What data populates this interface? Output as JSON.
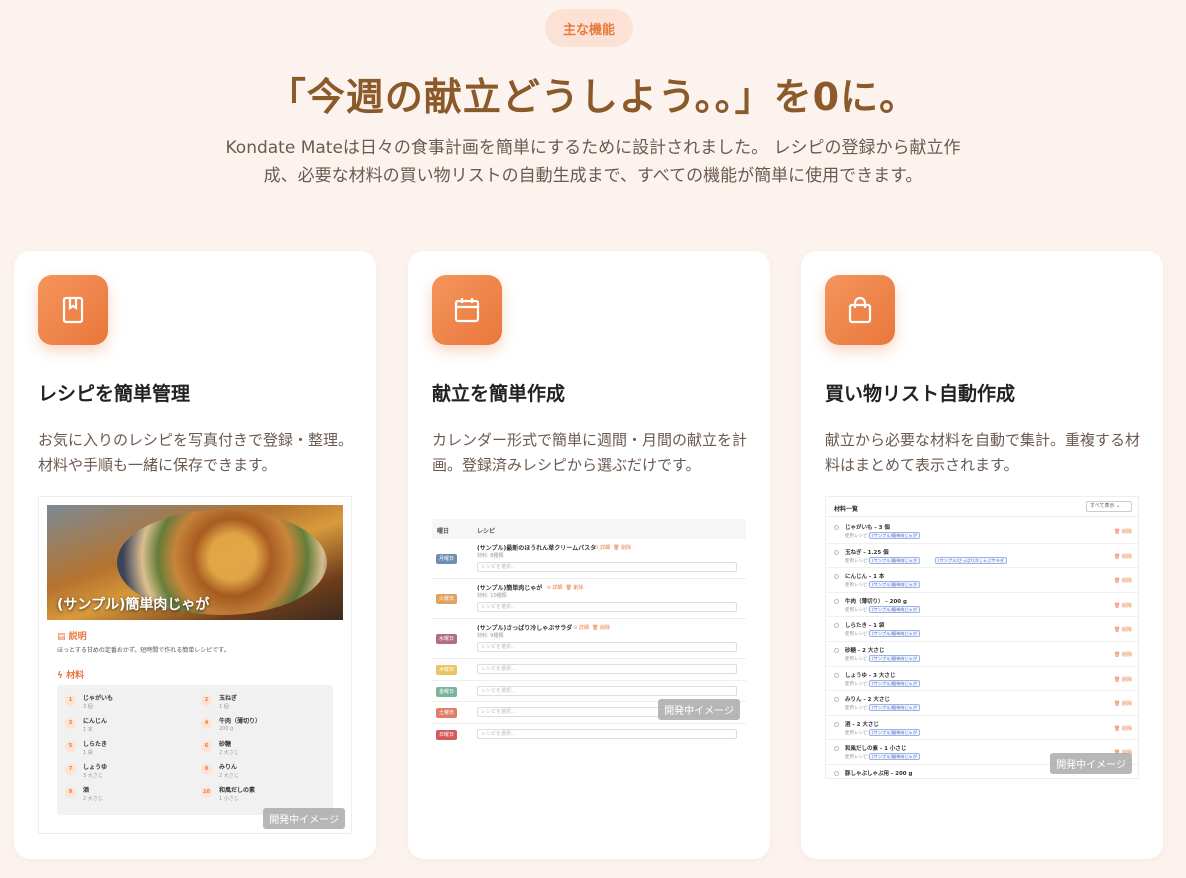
{
  "header": {
    "badge": "主な機能",
    "headline": "「今週の献立どうしよう。。」を0に。",
    "lead_line1": "Kondate Mateは日々の食事計画を簡単にするために設計されました。 レシピの登録から献立作",
    "lead_line2": "成、必要な材料の買い物リストの自動生成まで、すべての機能が簡単に使用できます。"
  },
  "features": [
    {
      "icon": "bookmark-icon",
      "title": "レシピを簡単管理",
      "desc": "お気に入りのレシピを写真付きで登録・整理。材料や手順も一緒に保存できます。"
    },
    {
      "icon": "calendar-icon",
      "title": "献立を簡単作成",
      "desc": "カレンダー形式で簡単に週間・月間の献立を計画。登録済みレシピから選ぶだけです。"
    },
    {
      "icon": "shopping-bag-icon",
      "title": "買い物リスト自動作成",
      "desc": "献立から必要な材料を自動で集計。重複する材料はまとめて表示されます。"
    }
  ],
  "dev_tag": "開発中イメージ",
  "recipe_mock": {
    "photo_caption": "(サンプル)簡単肉じゃが",
    "desc_heading": "説明",
    "desc_text": "ほっとする甘めの定番おかず。短時間で作れる簡単レシピです。",
    "ing_heading": "材料",
    "ingredients": [
      {
        "num": "1",
        "name": "じゃがいも",
        "qty": "3 個"
      },
      {
        "num": "2",
        "name": "玉ねぎ",
        "qty": "1 個"
      },
      {
        "num": "3",
        "name": "にんじん",
        "qty": "1 本"
      },
      {
        "num": "4",
        "name": "牛肉（薄切り）",
        "qty": "200 g"
      },
      {
        "num": "5",
        "name": "しらたき",
        "qty": "1 袋"
      },
      {
        "num": "6",
        "name": "砂糖",
        "qty": "2 大さじ"
      },
      {
        "num": "7",
        "name": "しょうゆ",
        "qty": "3 大さじ"
      },
      {
        "num": "8",
        "name": "みりん",
        "qty": "2 大さじ"
      },
      {
        "num": "9",
        "name": "酒",
        "qty": "2 大さじ"
      },
      {
        "num": "10",
        "name": "和風だしの素",
        "qty": "1 小さじ"
      }
    ]
  },
  "calendar_mock": {
    "col_day": "曜日",
    "col_recipe": "レシピ",
    "edit": "詳細",
    "remove": "削除",
    "placeholder": "レシピを選択...",
    "rows": [
      {
        "day": "月曜日",
        "color": "#6f8fb0",
        "recipe": "(サンプル)最新のほうれん草クリームパスタ",
        "meta": "材料: 8種類"
      },
      {
        "day": "火曜日",
        "color": "#e0a25e",
        "recipe": "(サンプル)簡単肉じゃが",
        "meta": "材料: 10種類"
      },
      {
        "day": "水曜日",
        "color": "#b06d8a",
        "recipe": "(サンプル)さっぱり冷しゃぶサラダ",
        "meta": "材料: 9種類"
      },
      {
        "day": "木曜日",
        "color": "#e8c660",
        "recipe": "",
        "meta": ""
      },
      {
        "day": "金曜日",
        "color": "#78b59a",
        "recipe": "",
        "meta": ""
      },
      {
        "day": "土曜日",
        "color": "#e07d67",
        "recipe": "",
        "meta": ""
      },
      {
        "day": "日曜日",
        "color": "#d45a5a",
        "recipe": "",
        "meta": ""
      }
    ]
  },
  "shopping_mock": {
    "title": "材料一覧",
    "filter": "すべて表示",
    "used_label": "使用レシピ:",
    "delete": "削除",
    "items": [
      {
        "name": "じゃがいも - 3 個",
        "tags": [
          "(サンプル)簡単肉じゃが"
        ]
      },
      {
        "name": "玉ねぎ - 1.25 個",
        "tags": [
          "(サンプル)簡単肉じゃが",
          "(サンプル)さっぱり冷しゃぶサラダ"
        ]
      },
      {
        "name": "にんじん - 1 本",
        "tags": [
          "(サンプル)簡単肉じゃが"
        ]
      },
      {
        "name": "牛肉（薄切り） - 200 g",
        "tags": [
          "(サンプル)簡単肉じゃが"
        ]
      },
      {
        "name": "しらたき - 1 袋",
        "tags": [
          "(サンプル)簡単肉じゃが"
        ]
      },
      {
        "name": "砂糖 - 2 大さじ",
        "tags": [
          "(サンプル)簡単肉じゃが"
        ]
      },
      {
        "name": "しょうゆ - 3 大さじ",
        "tags": [
          "(サンプル)簡単肉じゃが"
        ]
      },
      {
        "name": "みりん - 2 大さじ",
        "tags": [
          "(サンプル)簡単肉じゃが"
        ]
      },
      {
        "name": "酒 - 2 大さじ",
        "tags": [
          "(サンプル)簡単肉じゃが"
        ]
      },
      {
        "name": "和風だしの素 - 1 小さじ",
        "tags": [
          "(サンプル)簡単肉じゃが"
        ]
      },
      {
        "name": "豚しゃぶしゃぶ用 - 200 g",
        "tags": []
      }
    ]
  }
}
